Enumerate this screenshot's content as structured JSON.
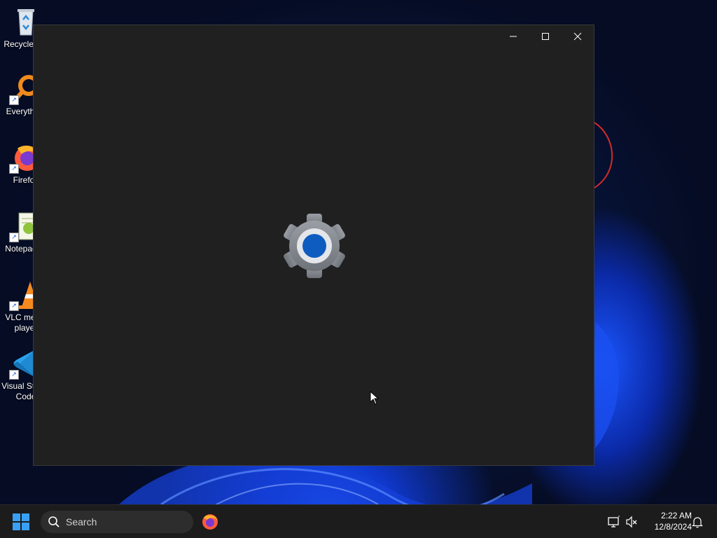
{
  "desktop": {
    "icons": [
      {
        "label": "Recycle Bin",
        "icon": "recycle-bin-icon"
      },
      {
        "label": "Everything",
        "icon": "everything-search-icon"
      },
      {
        "label": "Firefox",
        "icon": "firefox-icon"
      },
      {
        "label": "Notepad++",
        "icon": "notepad-plus-plus-icon"
      },
      {
        "label": "VLC media player",
        "icon": "vlc-icon"
      },
      {
        "label": "Visual Studio Code",
        "icon": "vscode-icon"
      }
    ]
  },
  "window": {
    "app": "Settings",
    "splash_icon": "settings-gear-icon",
    "controls": [
      "minimize-icon",
      "maximize-icon",
      "close-icon"
    ]
  },
  "taskbar": {
    "start_icon": "windows-start-icon",
    "search_placeholder": "Search",
    "pinned": [
      "firefox-icon"
    ],
    "tray": [
      "network-icon",
      "volume-muted-icon",
      "notification-bell-icon"
    ],
    "time": "2:22 AM",
    "date": "12/8/2024"
  },
  "colors": {
    "window_bg": "#202020",
    "taskbar_bg": "#1c1c1c",
    "accent_blue": "#0f5cc0",
    "gear_gray": "#8a8d93"
  }
}
